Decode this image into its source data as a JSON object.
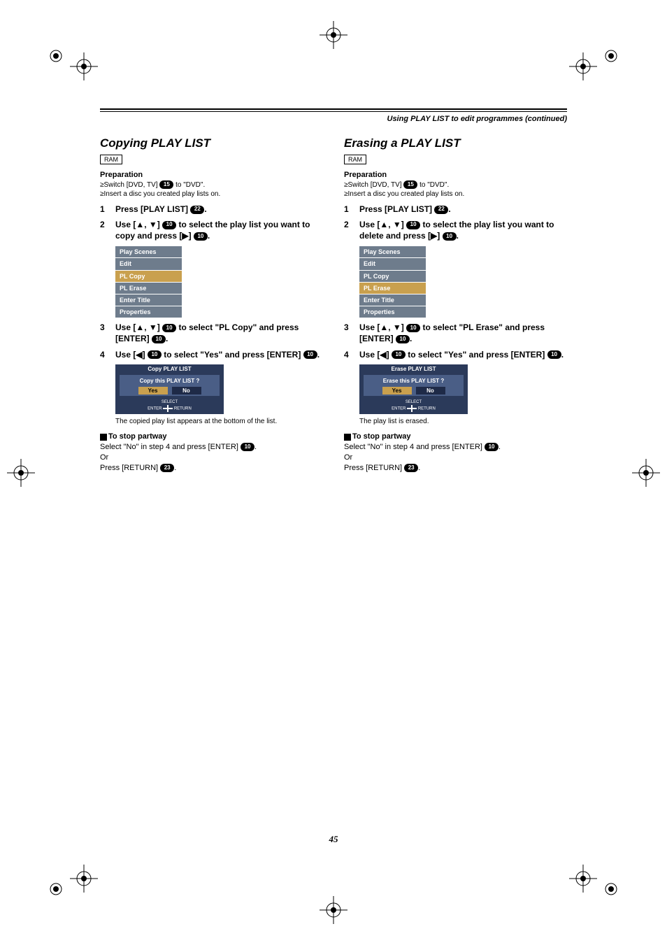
{
  "running_head": "Using PLAY LIST to edit programmes (continued)",
  "page_number": "45",
  "left": {
    "title": "Copying PLAY LIST",
    "ram": "RAM",
    "prep_label": "Preparation",
    "prep_items": [
      "≥Switch [DVD, TV] (15) to \"DVD\".",
      "≥Insert a disc you created play lists on."
    ],
    "switch_prefix": "≥Switch [DVD, TV]",
    "switch_ref": "15",
    "switch_suffix": " to \"DVD\".",
    "insert_line": "≥Insert a disc you created play lists on.",
    "step1": {
      "num": "1",
      "text_a": "Press [PLAY LIST] ",
      "ref": "22",
      "text_b": "."
    },
    "step2": {
      "num": "2",
      "text_a": "Use [▲, ▼] ",
      "ref1": "10",
      "text_b": " to select the play list you want to copy and press [▶] ",
      "ref2": "10",
      "text_c": "."
    },
    "menu": [
      "Play Scenes",
      "Edit",
      "PL Copy",
      "PL Erase",
      "Enter Title",
      "Properties"
    ],
    "menu_highlight_index": 2,
    "step3": {
      "num": "3",
      "text_a": "Use [▲, ▼] ",
      "ref1": "10",
      "text_b": " to select \"PL Copy\" and press [ENTER] ",
      "ref2": "10",
      "text_c": "."
    },
    "step4": {
      "num": "4",
      "text_a": "Use [◀] ",
      "ref1": "10",
      "text_b": " to select \"Yes\" and press [ENTER] ",
      "ref2": "10",
      "text_c": "."
    },
    "dialog": {
      "title": "Copy PLAY LIST",
      "question": "Copy this PLAY LIST ?",
      "yes": "Yes",
      "no": "No",
      "foot_select": "SELECT",
      "foot_enter": "ENTER",
      "foot_return": "RETURN"
    },
    "result": "The copied play list appears at the bottom of the list.",
    "stop_title": "To stop partway",
    "stop_line_a": "Select \"No\" in step 4 and press [ENTER] ",
    "stop_ref": "10",
    "stop_line_b": ".",
    "or": "Or",
    "return_a": "Press [RETURN] ",
    "return_ref": "23",
    "return_b": "."
  },
  "right": {
    "title": "Erasing a PLAY LIST",
    "ram": "RAM",
    "prep_label": "Preparation",
    "switch_prefix": "≥Switch [DVD, TV]",
    "switch_ref": "15",
    "switch_suffix": " to \"DVD\".",
    "insert_line": "≥Insert a disc you created play lists on.",
    "step1": {
      "num": "1",
      "text_a": "Press [PLAY LIST] ",
      "ref": "22",
      "text_b": "."
    },
    "step2": {
      "num": "2",
      "text_a": "Use [▲, ▼] ",
      "ref1": "10",
      "text_b": " to select the play list you want to delete and press [▶] ",
      "ref2": "10",
      "text_c": "."
    },
    "menu": [
      "Play Scenes",
      "Edit",
      "PL Copy",
      "PL Erase",
      "Enter Title",
      "Properties"
    ],
    "menu_highlight_index": 3,
    "step3": {
      "num": "3",
      "text_a": "Use [▲, ▼] ",
      "ref1": "10",
      "text_b": " to select \"PL Erase\" and press [ENTER] ",
      "ref2": "10",
      "text_c": "."
    },
    "step4": {
      "num": "4",
      "text_a": "Use [◀] ",
      "ref1": "10",
      "text_b": " to select \"Yes\" and press [ENTER] ",
      "ref2": "10",
      "text_c": "."
    },
    "dialog": {
      "title": "Erase PLAY LIST",
      "question": "Erase this PLAY LIST ?",
      "yes": "Yes",
      "no": "No",
      "foot_select": "SELECT",
      "foot_enter": "ENTER",
      "foot_return": "RETURN"
    },
    "result": "The play list is erased.",
    "stop_title": "To stop partway",
    "stop_line_a": "Select \"No\" in step 4 and press [ENTER] ",
    "stop_ref": "10",
    "stop_line_b": ".",
    "or": "Or",
    "return_a": "Press [RETURN] ",
    "return_ref": "23",
    "return_b": "."
  }
}
